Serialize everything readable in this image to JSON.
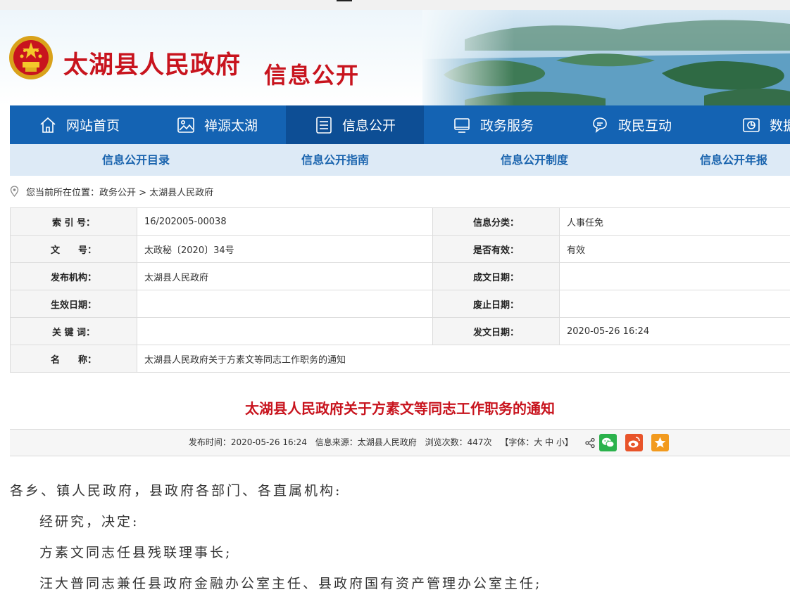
{
  "header": {
    "site_title": "太湖县人民政府",
    "section_title": "信息公开"
  },
  "nav": {
    "items": [
      {
        "label": "网站首页",
        "icon": "home-icon"
      },
      {
        "label": "禅源太湖",
        "icon": "image-icon"
      },
      {
        "label": "信息公开",
        "icon": "document-icon",
        "active": true
      },
      {
        "label": "政务服务",
        "icon": "monitor-icon"
      },
      {
        "label": "政民互动",
        "icon": "chat-icon"
      },
      {
        "label": "数据",
        "icon": "chart-icon"
      }
    ]
  },
  "subnav": {
    "items": [
      "信息公开目录",
      "信息公开指南",
      "信息公开制度",
      "信息公开年报"
    ]
  },
  "breadcrumb": {
    "text": "您当前所在位置：政务公开 > 太湖县人民政府"
  },
  "info": {
    "rows": [
      {
        "l1": "索 引 号：",
        "v1": "16/202005-00038",
        "l2": "信息分类：",
        "v2": "人事任免"
      },
      {
        "l1": "文　　号：",
        "v1": "太政秘〔2020〕34号",
        "l2": "是否有效：",
        "v2": "有效"
      },
      {
        "l1": "发布机构：",
        "v1": "太湖县人民政府",
        "l2": "成文日期：",
        "v2": ""
      },
      {
        "l1": "生效日期：",
        "v1": "",
        "l2": "废止日期：",
        "v2": ""
      },
      {
        "l1": "关 键 词：",
        "v1": "",
        "l2": "发文日期：",
        "v2": "2020-05-26 16:24"
      }
    ],
    "name_label": "名　　称：",
    "name_value": "太湖县人民政府关于方素文等同志工作职务的通知"
  },
  "article": {
    "title": "太湖县人民政府关于方素文等同志工作职务的通知",
    "meta": {
      "publish_time": "发布时间：2020-05-26 16:24",
      "source": "信息来源：太湖县人民政府",
      "views": "浏览次数：447次",
      "font_size": "【字体：大 中 小】"
    },
    "paragraphs": [
      "各乡、镇人民政府，县政府各部门、各直属机构:",
      "经研究，决定:",
      "方素文同志任县残联理事长;",
      "汪大普同志兼任县政府金融办公室主任、县政府国有资产管理办公室主任;"
    ]
  },
  "colors": {
    "brand_red": "#c8141e",
    "nav_blue": "#1463b3",
    "nav_active": "#0d4e95",
    "subnav_bg": "#ddeaf6",
    "subnav_text": "#1a64ae"
  }
}
